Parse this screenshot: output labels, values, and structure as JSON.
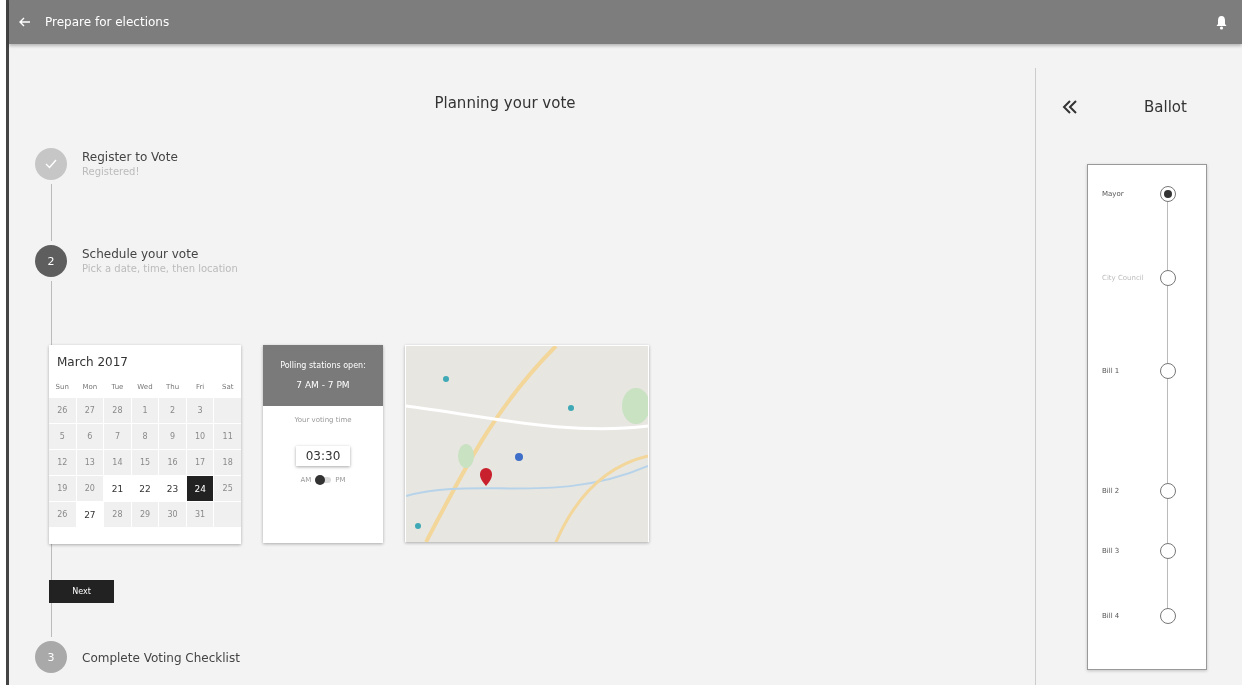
{
  "header": {
    "title": "Prepare for elections"
  },
  "main": {
    "title": "Planning your vote",
    "steps": [
      {
        "kind": "done",
        "title": "Register to Vote",
        "subtitle": "Registered!"
      },
      {
        "kind": "active",
        "badge": "2",
        "title": "Schedule your vote",
        "subtitle": "Pick a date, time, then location"
      },
      {
        "kind": "pending",
        "badge": "3",
        "title": "Complete Voting Checklist"
      }
    ],
    "calendar": {
      "month": "March 2017",
      "weekdays": [
        "Sun",
        "Mon",
        "Tue",
        "Wed",
        "Thu",
        "Fri",
        "Sat"
      ],
      "weeks": [
        [
          {
            "day": "26",
            "available": false,
            "selected": false
          },
          {
            "day": "27",
            "available": false,
            "selected": false
          },
          {
            "day": "28",
            "available": false,
            "selected": false
          },
          {
            "day": "1",
            "available": false,
            "selected": false
          },
          {
            "day": "2",
            "available": false,
            "selected": false
          },
          {
            "day": "3",
            "available": false,
            "selected": false
          }
        ],
        [
          {
            "day": "5",
            "available": false,
            "selected": false
          },
          {
            "day": "6",
            "available": false,
            "selected": false
          },
          {
            "day": "7",
            "available": false,
            "selected": false
          },
          {
            "day": "8",
            "available": false,
            "selected": false
          },
          {
            "day": "9",
            "available": false,
            "selected": false
          },
          {
            "day": "10",
            "available": false,
            "selected": false
          },
          {
            "day": "11",
            "available": false,
            "selected": false
          }
        ],
        [
          {
            "day": "12",
            "available": false,
            "selected": false
          },
          {
            "day": "13",
            "available": false,
            "selected": false
          },
          {
            "day": "14",
            "available": false,
            "selected": false
          },
          {
            "day": "15",
            "available": false,
            "selected": false
          },
          {
            "day": "16",
            "available": false,
            "selected": false
          },
          {
            "day": "17",
            "available": false,
            "selected": false
          },
          {
            "day": "18",
            "available": false,
            "selected": false
          }
        ],
        [
          {
            "day": "19",
            "available": false,
            "selected": false
          },
          {
            "day": "20",
            "available": false,
            "selected": false
          },
          {
            "day": "21",
            "available": true,
            "selected": false
          },
          {
            "day": "22",
            "available": true,
            "selected": false
          },
          {
            "day": "23",
            "available": true,
            "selected": false
          },
          {
            "day": "24",
            "available": true,
            "selected": true
          },
          {
            "day": "25",
            "available": false,
            "selected": false
          }
        ],
        [
          {
            "day": "26",
            "available": false,
            "selected": false
          },
          {
            "day": "27",
            "available": true,
            "selected": false
          },
          {
            "day": "28",
            "available": false,
            "selected": false
          },
          {
            "day": "29",
            "available": false,
            "selected": false
          },
          {
            "day": "30",
            "available": false,
            "selected": false
          },
          {
            "day": "31",
            "available": false,
            "selected": false
          }
        ]
      ]
    },
    "time": {
      "heading": "Polling stations open:",
      "hours": "7 AM - 7 PM",
      "label": "Your voting time",
      "value": "03:30",
      "am": "AM",
      "pm": "PM",
      "pm_on": false
    },
    "next_button": "Next"
  },
  "ballot": {
    "title": "Ballot",
    "items": [
      {
        "label": "Mayor",
        "selected": true,
        "disabled": false
      },
      {
        "label": "City Council",
        "selected": false,
        "disabled": true
      },
      {
        "label": "Bill 1",
        "selected": false,
        "disabled": false
      },
      {
        "label": "Bill 2",
        "selected": false,
        "disabled": false
      },
      {
        "label": "Bill 3",
        "selected": false,
        "disabled": false
      },
      {
        "label": "Bill 4",
        "selected": false,
        "disabled": false
      }
    ]
  }
}
